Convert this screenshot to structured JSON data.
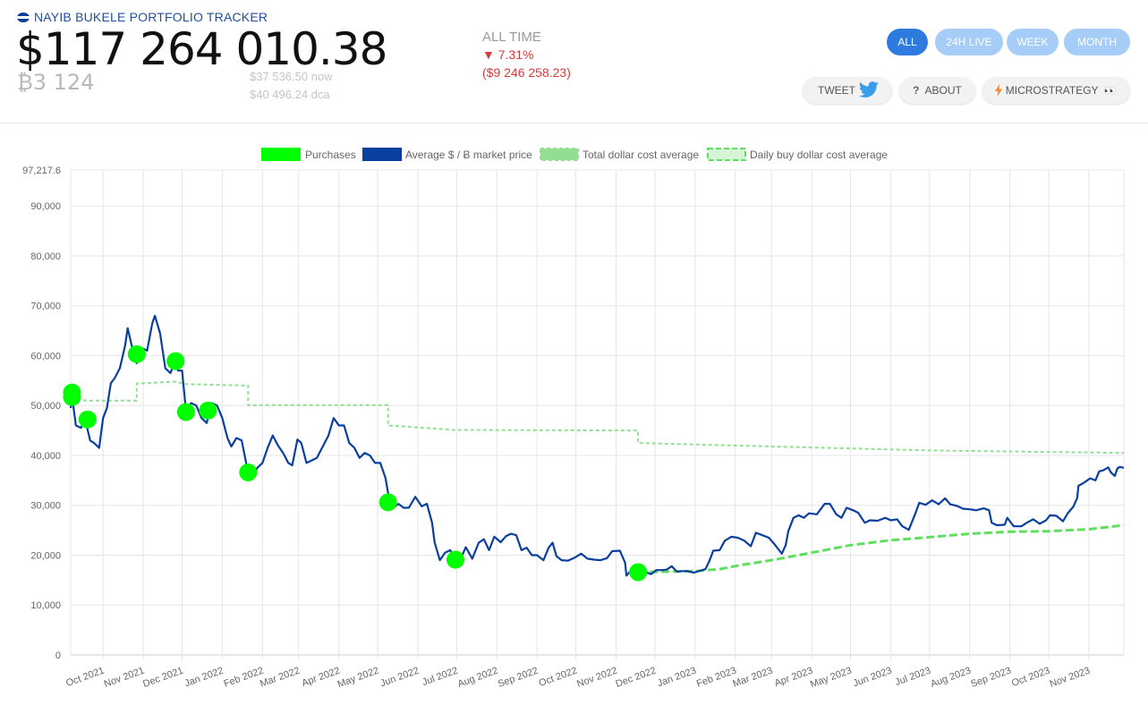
{
  "header": {
    "app_title": "NAYIB BUKELE PORTFOLIO TRACKER",
    "total_usd": "$117 264 010.38",
    "total_btc": "₿3 124",
    "price_now": "$37 536.50 now",
    "price_dca": "$40 496.24 dca",
    "performance": {
      "label": "ALL TIME",
      "percent": "▼ 7.31%",
      "change": "($9 246 258.23)"
    }
  },
  "range_buttons": [
    {
      "label": "ALL",
      "active": true
    },
    {
      "label": "24H LIVE",
      "active": false
    },
    {
      "label": "WEEK",
      "active": false
    },
    {
      "label": "MONTH",
      "active": false
    }
  ],
  "actions": {
    "tweet": "TWEET",
    "about_icon": "?",
    "about": "ABOUT",
    "microstrategy": "MICROSTRATEGY",
    "microstrategy_emoji": "👀"
  },
  "icons": {
    "flag": "el-salvador-flag-icon",
    "twitter": "twitter-bird-icon",
    "about": "question-mark-icon",
    "microstrategy": "lightning-icon"
  },
  "colors": {
    "price_line": "#0a3fa0",
    "purchases": "#00ff00",
    "total_dca": "#93de93",
    "daily_dca": "#5ee05e",
    "active_button": "#2e7be0",
    "inactive_button": "#a6cdf7",
    "negative": "#e03838"
  },
  "chart_data": {
    "type": "line",
    "title": "",
    "legend": {
      "placement": "top-center",
      "items": [
        "Purchases",
        "Average $ / Ƀ market price",
        "Total dollar cost average",
        "Daily buy dollar cost average"
      ]
    },
    "x_ticks": [
      "Oct 2021",
      "Nov 2021",
      "Dec 2021",
      "Jan 2022",
      "Feb 2022",
      "Mar 2022",
      "Apr 2022",
      "May 2022",
      "Jun 2022",
      "Jul 2022",
      "Aug 2022",
      "Sep 2022",
      "Oct 2022",
      "Nov 2022",
      "Dec 2022",
      "Jan 2023",
      "Feb 2023",
      "Mar 2023",
      "Apr 2023",
      "May 2023",
      "Jun 2023",
      "Jul 2023",
      "Aug 2023",
      "Sep 2023",
      "Oct 2023",
      "Nov 2023"
    ],
    "y_ticks": [
      "0",
      "10,000",
      "20,000",
      "30,000",
      "40,000",
      "50,000",
      "60,000",
      "70,000",
      "80,000",
      "90,000",
      "97,217.6"
    ],
    "x_range": [
      "2021-09-06",
      "2023-11-28"
    ],
    "y_range": [
      0,
      97217.6
    ],
    "grid": true,
    "series": [
      {
        "name": "Average $ / Ƀ market price",
        "style": "line",
        "points": [
          [
            "2021-09-06",
            49500
          ],
          [
            "2021-09-07",
            52000
          ],
          [
            "2021-09-10",
            46000
          ],
          [
            "2021-09-14",
            45500
          ],
          [
            "2021-09-17",
            47500
          ],
          [
            "2021-09-21",
            43000
          ],
          [
            "2021-09-24",
            42500
          ],
          [
            "2021-09-28",
            41500
          ],
          [
            "2021-10-01",
            47500
          ],
          [
            "2021-10-04",
            49500
          ],
          [
            "2021-10-07",
            54500
          ],
          [
            "2021-10-10",
            55500
          ],
          [
            "2021-10-14",
            57500
          ],
          [
            "2021-10-18",
            62000
          ],
          [
            "2021-10-20",
            65500
          ],
          [
            "2021-10-24",
            61000
          ],
          [
            "2021-10-27",
            58500
          ],
          [
            "2021-10-31",
            61500
          ],
          [
            "2021-11-04",
            61000
          ],
          [
            "2021-11-08",
            66500
          ],
          [
            "2021-11-10",
            68000
          ],
          [
            "2021-11-14",
            64500
          ],
          [
            "2021-11-18",
            57500
          ],
          [
            "2021-11-22",
            56500
          ],
          [
            "2021-11-25",
            58500
          ],
          [
            "2021-11-28",
            57000
          ],
          [
            "2021-12-01",
            57000
          ],
          [
            "2021-12-04",
            49000
          ],
          [
            "2021-12-08",
            50500
          ],
          [
            "2021-12-12",
            50000
          ],
          [
            "2021-12-16",
            47500
          ],
          [
            "2021-12-20",
            46500
          ],
          [
            "2021-12-24",
            50500
          ],
          [
            "2021-12-28",
            50000
          ],
          [
            "2022-01-01",
            47500
          ],
          [
            "2022-01-05",
            43500
          ],
          [
            "2022-01-08",
            41800
          ],
          [
            "2022-01-12",
            43500
          ],
          [
            "2022-01-16",
            43000
          ],
          [
            "2022-01-21",
            36500
          ],
          [
            "2022-01-24",
            35500
          ],
          [
            "2022-01-28",
            37500
          ],
          [
            "2022-02-01",
            38500
          ],
          [
            "2022-02-05",
            41500
          ],
          [
            "2022-02-09",
            44000
          ],
          [
            "2022-02-13",
            42000
          ],
          [
            "2022-02-17",
            40500
          ],
          [
            "2022-02-21",
            38500
          ],
          [
            "2022-02-24",
            38000
          ],
          [
            "2022-02-28",
            43200
          ],
          [
            "2022-03-03",
            42500
          ],
          [
            "2022-03-07",
            38500
          ],
          [
            "2022-03-11",
            39000
          ],
          [
            "2022-03-15",
            39500
          ],
          [
            "2022-03-19",
            41500
          ],
          [
            "2022-03-24",
            44000
          ],
          [
            "2022-03-28",
            47500
          ],
          [
            "2022-04-01",
            46000
          ],
          [
            "2022-04-05",
            46000
          ],
          [
            "2022-04-09",
            42500
          ],
          [
            "2022-04-13",
            41500
          ],
          [
            "2022-04-17",
            39500
          ],
          [
            "2022-04-21",
            40500
          ],
          [
            "2022-04-25",
            40000
          ],
          [
            "2022-04-29",
            38500
          ],
          [
            "2022-05-03",
            38500
          ],
          [
            "2022-05-07",
            35500
          ],
          [
            "2022-05-10",
            31000
          ],
          [
            "2022-05-13",
            29500
          ],
          [
            "2022-05-17",
            30300
          ],
          [
            "2022-05-21",
            29500
          ],
          [
            "2022-05-25",
            29500
          ],
          [
            "2022-05-30",
            31700
          ],
          [
            "2022-06-04",
            29800
          ],
          [
            "2022-06-08",
            30300
          ],
          [
            "2022-06-12",
            26500
          ],
          [
            "2022-06-14",
            22500
          ],
          [
            "2022-06-18",
            19000
          ],
          [
            "2022-06-22",
            20500
          ],
          [
            "2022-06-26",
            21000
          ],
          [
            "2022-06-30",
            19000
          ],
          [
            "2022-07-04",
            19300
          ],
          [
            "2022-07-08",
            21600
          ],
          [
            "2022-07-13",
            19300
          ],
          [
            "2022-07-18",
            22500
          ],
          [
            "2022-07-22",
            23200
          ],
          [
            "2022-07-26",
            21000
          ],
          [
            "2022-07-30",
            23700
          ],
          [
            "2022-08-04",
            22600
          ],
          [
            "2022-08-08",
            23800
          ],
          [
            "2022-08-12",
            24300
          ],
          [
            "2022-08-16",
            24000
          ],
          [
            "2022-08-20",
            21000
          ],
          [
            "2022-08-24",
            21500
          ],
          [
            "2022-08-28",
            20000
          ],
          [
            "2022-09-01",
            20000
          ],
          [
            "2022-09-06",
            19000
          ],
          [
            "2022-09-10",
            21500
          ],
          [
            "2022-09-13",
            22500
          ],
          [
            "2022-09-16",
            19800
          ],
          [
            "2022-09-20",
            19000
          ],
          [
            "2022-09-25",
            18900
          ],
          [
            "2022-09-30",
            19500
          ],
          [
            "2022-10-05",
            20300
          ],
          [
            "2022-10-10",
            19300
          ],
          [
            "2022-10-15",
            19100
          ],
          [
            "2022-10-20",
            19000
          ],
          [
            "2022-10-25",
            19400
          ],
          [
            "2022-10-29",
            20800
          ],
          [
            "2022-11-04",
            20900
          ],
          [
            "2022-11-08",
            18500
          ],
          [
            "2022-11-09",
            15900
          ],
          [
            "2022-11-12",
            16800
          ],
          [
            "2022-11-16",
            16700
          ],
          [
            "2022-11-20",
            16300
          ],
          [
            "2022-11-24",
            16600
          ],
          [
            "2022-11-28",
            16200
          ],
          [
            "2022-12-02",
            17000
          ],
          [
            "2022-12-06",
            17000
          ],
          [
            "2022-12-10",
            17100
          ],
          [
            "2022-12-14",
            17800
          ],
          [
            "2022-12-18",
            16700
          ],
          [
            "2022-12-22",
            16800
          ],
          [
            "2022-12-26",
            16800
          ],
          [
            "2022-12-31",
            16500
          ],
          [
            "2023-01-04",
            16800
          ],
          [
            "2023-01-09",
            17200
          ],
          [
            "2023-01-12",
            18800
          ],
          [
            "2023-01-15",
            20900
          ],
          [
            "2023-01-20",
            21000
          ],
          [
            "2023-01-24",
            22900
          ],
          [
            "2023-01-29",
            23700
          ],
          [
            "2023-02-03",
            23500
          ],
          [
            "2023-02-08",
            22900
          ],
          [
            "2023-02-13",
            21800
          ],
          [
            "2023-02-17",
            24500
          ],
          [
            "2023-02-22",
            24000
          ],
          [
            "2023-02-27",
            23500
          ],
          [
            "2023-03-03",
            22300
          ],
          [
            "2023-03-09",
            20300
          ],
          [
            "2023-03-12",
            22000
          ],
          [
            "2023-03-14",
            24800
          ],
          [
            "2023-03-18",
            27500
          ],
          [
            "2023-03-22",
            28000
          ],
          [
            "2023-03-26",
            27500
          ],
          [
            "2023-03-30",
            28400
          ],
          [
            "2023-04-05",
            28200
          ],
          [
            "2023-04-11",
            30300
          ],
          [
            "2023-04-15",
            30300
          ],
          [
            "2023-04-20",
            28200
          ],
          [
            "2023-04-24",
            27500
          ],
          [
            "2023-04-28",
            29500
          ],
          [
            "2023-05-03",
            29000
          ],
          [
            "2023-05-07",
            28500
          ],
          [
            "2023-05-12",
            26500
          ],
          [
            "2023-05-16",
            27000
          ],
          [
            "2023-05-22",
            26900
          ],
          [
            "2023-05-28",
            27500
          ],
          [
            "2023-06-01",
            27000
          ],
          [
            "2023-06-06",
            27200
          ],
          [
            "2023-06-10",
            25800
          ],
          [
            "2023-06-15",
            25100
          ],
          [
            "2023-06-20",
            28300
          ],
          [
            "2023-06-23",
            30500
          ],
          [
            "2023-06-28",
            30100
          ],
          [
            "2023-07-03",
            31000
          ],
          [
            "2023-07-08",
            30200
          ],
          [
            "2023-07-13",
            31400
          ],
          [
            "2023-07-17",
            30200
          ],
          [
            "2023-07-22",
            29900
          ],
          [
            "2023-07-27",
            29300
          ],
          [
            "2023-08-01",
            29200
          ],
          [
            "2023-08-06",
            29000
          ],
          [
            "2023-08-12",
            29400
          ],
          [
            "2023-08-16",
            29000
          ],
          [
            "2023-08-18",
            26500
          ],
          [
            "2023-08-22",
            26000
          ],
          [
            "2023-08-28",
            26100
          ],
          [
            "2023-08-30",
            27500
          ],
          [
            "2023-09-04",
            25800
          ],
          [
            "2023-09-10",
            25800
          ],
          [
            "2023-09-14",
            26500
          ],
          [
            "2023-09-19",
            27200
          ],
          [
            "2023-09-24",
            26300
          ],
          [
            "2023-09-29",
            27000
          ],
          [
            "2023-10-02",
            28000
          ],
          [
            "2023-10-07",
            27900
          ],
          [
            "2023-10-12",
            26800
          ],
          [
            "2023-10-16",
            28500
          ],
          [
            "2023-10-20",
            29700
          ],
          [
            "2023-10-23",
            31500
          ],
          [
            "2023-10-24",
            33900
          ],
          [
            "2023-10-28",
            34500
          ],
          [
            "2023-11-02",
            35400
          ],
          [
            "2023-11-06",
            35000
          ],
          [
            "2023-11-09",
            36800
          ],
          [
            "2023-11-12",
            37000
          ],
          [
            "2023-11-16",
            37600
          ],
          [
            "2023-11-18",
            36600
          ],
          [
            "2023-11-21",
            35900
          ],
          [
            "2023-11-23",
            37400
          ],
          [
            "2023-11-25",
            37700
          ],
          [
            "2023-11-28",
            37500
          ]
        ]
      },
      {
        "name": "Purchases",
        "style": "points",
        "points": [
          [
            "2021-09-07",
            52600
          ],
          [
            "2021-09-07",
            51700
          ],
          [
            "2021-09-19",
            47200
          ],
          [
            "2021-10-27",
            60300
          ],
          [
            "2021-11-26",
            58900
          ],
          [
            "2021-12-04",
            48700
          ],
          [
            "2021-12-21",
            49000
          ],
          [
            "2022-01-21",
            36600
          ],
          [
            "2022-05-09",
            30600
          ],
          [
            "2022-06-30",
            19100
          ],
          [
            "2022-11-18",
            16600
          ]
        ]
      },
      {
        "name": "Total dollar cost average",
        "style": "step-dashed",
        "points": [
          [
            "2021-09-06",
            51300
          ],
          [
            "2021-09-19",
            51000
          ],
          [
            "2021-10-27",
            51000
          ],
          [
            "2021-10-27",
            54400
          ],
          [
            "2021-11-26",
            54800
          ],
          [
            "2021-12-04",
            54300
          ],
          [
            "2022-01-21",
            54000
          ],
          [
            "2022-01-21",
            50100
          ],
          [
            "2022-05-09",
            50100
          ],
          [
            "2022-05-09",
            46000
          ],
          [
            "2022-06-30",
            45100
          ],
          [
            "2022-11-18",
            45000
          ],
          [
            "2022-11-18",
            42500
          ],
          [
            "2023-03-01",
            41800
          ],
          [
            "2023-07-01",
            41000
          ],
          [
            "2023-11-28",
            40500
          ]
        ]
      },
      {
        "name": "Daily buy dollar cost average",
        "style": "dashed",
        "points": [
          [
            "2022-11-18",
            16600
          ],
          [
            "2023-01-01",
            16800
          ],
          [
            "2023-01-20",
            17200
          ],
          [
            "2023-02-05",
            18000
          ],
          [
            "2023-03-01",
            19000
          ],
          [
            "2023-04-01",
            20500
          ],
          [
            "2023-05-01",
            22000
          ],
          [
            "2023-06-01",
            23000
          ],
          [
            "2023-07-01",
            23600
          ],
          [
            "2023-08-01",
            24300
          ],
          [
            "2023-09-01",
            24700
          ],
          [
            "2023-10-01",
            24800
          ],
          [
            "2023-11-01",
            25200
          ],
          [
            "2023-11-28",
            26000
          ]
        ]
      }
    ]
  }
}
